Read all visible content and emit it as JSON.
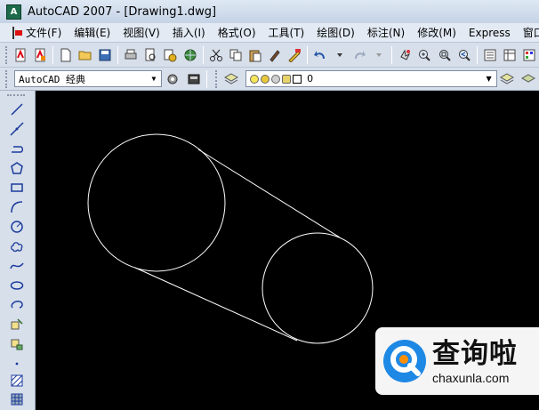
{
  "window": {
    "title": "AutoCAD 2007 - [Drawing1.dwg]",
    "app_icon_label": "A"
  },
  "menu": {
    "items": [
      "文件(F)",
      "编辑(E)",
      "视图(V)",
      "插入(I)",
      "格式(O)",
      "工具(T)",
      "绘图(D)",
      "标注(N)",
      "修改(M)",
      "Express",
      "窗口(W)"
    ]
  },
  "toolbar": {
    "workspace": "AutoCAD 经典",
    "layer_name": "0"
  },
  "left_toolbar": {
    "tools": [
      "line-icon",
      "construction-line-icon",
      "polyline-icon",
      "polygon-icon",
      "rectangle-icon",
      "arc-icon",
      "circle-icon",
      "revision-cloud-icon",
      "spline-icon",
      "ellipse-icon",
      "ellipse-arc-icon",
      "insert-block-icon",
      "make-block-icon",
      "point-icon",
      "hatch-icon",
      "gradient-icon"
    ]
  },
  "drawing": {
    "background": "#000000",
    "stroke": "#ffffff"
  },
  "watermark": {
    "title": "查询啦",
    "url": "chaxunla.com",
    "brand_color": "#1e88e5"
  }
}
